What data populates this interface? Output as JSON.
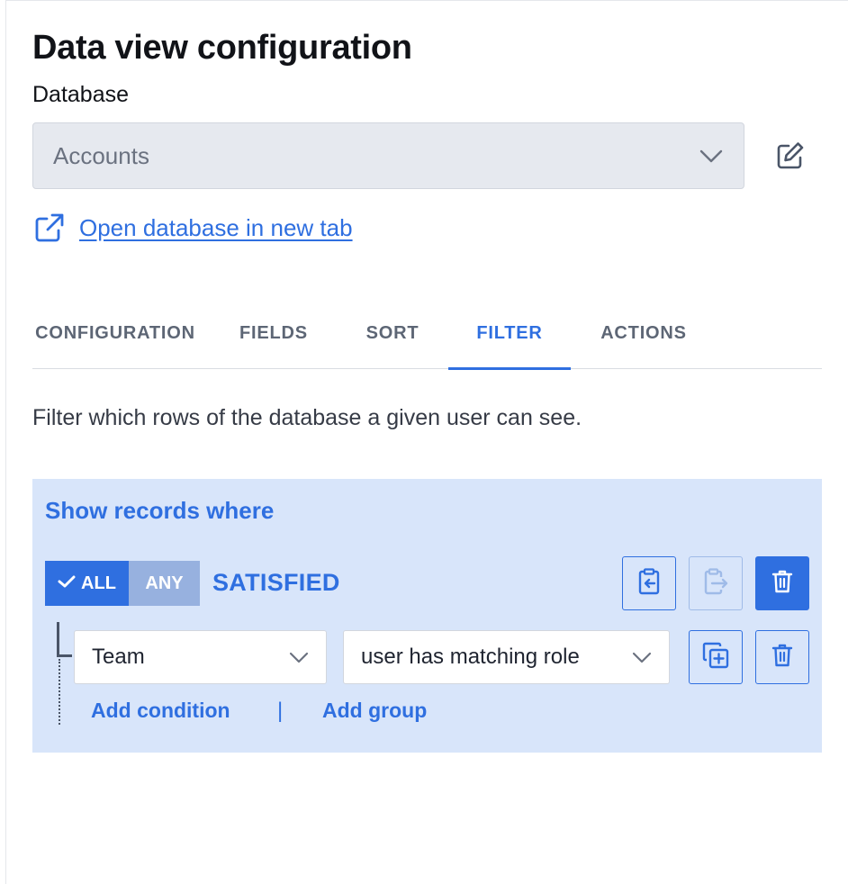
{
  "page": {
    "title": "Data view configuration"
  },
  "database": {
    "label": "Database",
    "selected": "Accounts",
    "open_link": "Open database in new tab"
  },
  "tabs": [
    {
      "label": "CONFIGURATION",
      "active": false
    },
    {
      "label": "FIELDS",
      "active": false
    },
    {
      "label": "SORT",
      "active": false
    },
    {
      "label": "FILTER",
      "active": true
    },
    {
      "label": "ACTIONS",
      "active": false
    }
  ],
  "filter": {
    "description": "Filter which rows of the database a given user can see.",
    "panel_title": "Show records where",
    "toggle": {
      "all": "ALL",
      "any": "ANY",
      "selected": "ALL"
    },
    "satisfied": "SATISFIED",
    "condition": {
      "field": "Team",
      "operator": "user has matching role"
    },
    "add_condition": "Add condition",
    "separator": "|",
    "add_group": "Add group"
  },
  "icons": {
    "select_chevron": "chevron-down-icon",
    "edit": "edit-icon",
    "external": "external-link-icon",
    "check": "check-icon",
    "paste": "clipboard-paste-icon",
    "copy": "clipboard-copy-icon",
    "delete": "trash-icon",
    "duplicate": "duplicate-icon"
  },
  "colors": {
    "accent": "#2f6fe0",
    "panel_bg": "#d8e5fa",
    "select_bg": "#e6e9ef",
    "any_bg": "#97b1df"
  }
}
